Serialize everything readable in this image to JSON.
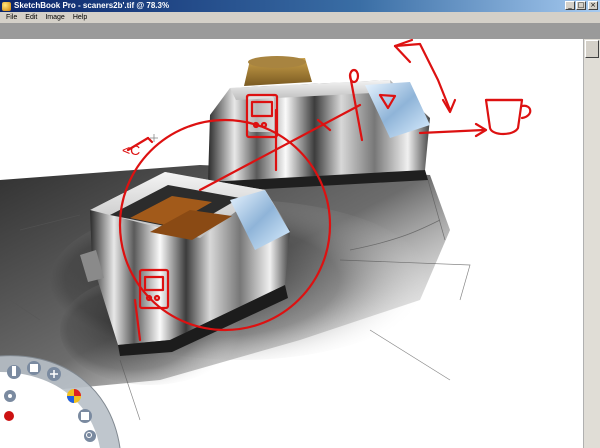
{
  "window": {
    "title": "SketchBook Pro - scaners2b'.tif @ 78.3%",
    "minimize_glyph": "_",
    "maximize_glyph": "□",
    "close_glyph": "×"
  },
  "menu": {
    "items": [
      "File",
      "Edit",
      "Image",
      "Help"
    ]
  },
  "canvas": {
    "annotation_text": "<C"
  },
  "colors": {
    "titlebar_start": "#0a246a",
    "titlebar_end": "#a6caf0",
    "ink_red": "#dd1111",
    "canvas_bg": "#ffffff",
    "frame_bg": "#8a8a8a"
  },
  "lagoon": {
    "icons": [
      "brush-icon",
      "eraser-icon",
      "color-wheel-icon",
      "layers-icon",
      "zoom-icon",
      "pan-icon",
      "record-icon"
    ]
  }
}
